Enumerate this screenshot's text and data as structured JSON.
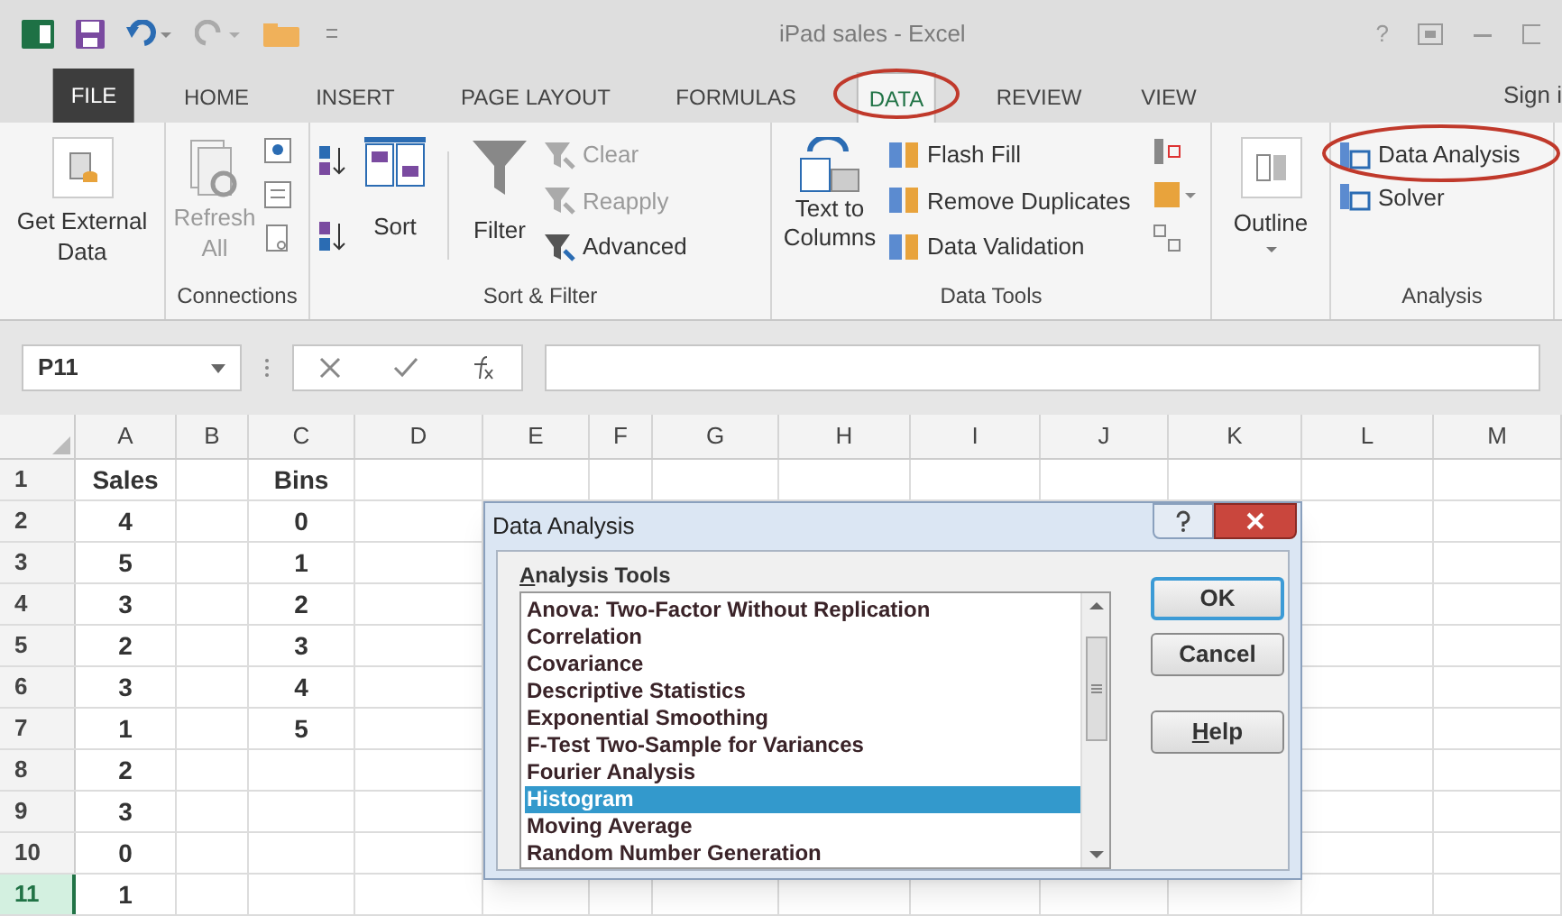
{
  "window": {
    "title": "iPad sales - Excel",
    "help": "?"
  },
  "tabs": [
    {
      "label": "FILE",
      "kind": "file",
      "selected": false,
      "highlighted": false
    },
    {
      "label": "HOME",
      "kind": "tab",
      "selected": false,
      "highlighted": false
    },
    {
      "label": "INSERT",
      "kind": "tab",
      "selected": false,
      "highlighted": false
    },
    {
      "label": "PAGE LAYOUT",
      "kind": "tab",
      "selected": false,
      "highlighted": false
    },
    {
      "label": "FORMULAS",
      "kind": "tab",
      "selected": false,
      "highlighted": false
    },
    {
      "label": "DATA",
      "kind": "tab",
      "selected": true,
      "highlighted": true
    },
    {
      "label": "REVIEW",
      "kind": "tab",
      "selected": false,
      "highlighted": false
    },
    {
      "label": "VIEW",
      "kind": "tab",
      "selected": false,
      "highlighted": false
    }
  ],
  "account": "Sign i",
  "ribbon": {
    "get_external_data": {
      "label": "Get External Data"
    },
    "connections": {
      "title": "Connections",
      "refresh": {
        "label": "Refresh All",
        "disabled": true
      }
    },
    "sort_filter": {
      "title": "Sort & Filter",
      "sort": "Sort",
      "filter": "Filter",
      "commands": [
        {
          "label": "Clear",
          "disabled": true
        },
        {
          "label": "Reapply",
          "disabled": true
        },
        {
          "label": "Advanced",
          "disabled": false
        }
      ]
    },
    "data_tools": {
      "title": "Data Tools",
      "text_to_columns": "Text to Columns",
      "commands": [
        {
          "label": "Flash Fill"
        },
        {
          "label": "Remove Duplicates"
        },
        {
          "label": "Data Validation"
        }
      ]
    },
    "outline": {
      "label": "Outline"
    },
    "analysis": {
      "title": "Analysis",
      "commands": [
        {
          "label": "Data Analysis",
          "highlighted": true
        },
        {
          "label": "Solver",
          "highlighted": false
        }
      ]
    }
  },
  "formula_bar": {
    "name_box": "P11"
  },
  "sheet": {
    "columns": [
      "A",
      "B",
      "C",
      "D",
      "E",
      "F",
      "G",
      "H",
      "I",
      "J",
      "K",
      "L",
      "M"
    ],
    "rows": [
      {
        "number": "1",
        "selected": false,
        "a": "Sales",
        "c": "Bins"
      },
      {
        "number": "2",
        "selected": false,
        "a": "4",
        "c": "0"
      },
      {
        "number": "3",
        "selected": false,
        "a": "5",
        "c": "1"
      },
      {
        "number": "4",
        "selected": false,
        "a": "3",
        "c": "2"
      },
      {
        "number": "5",
        "selected": false,
        "a": "2",
        "c": "3"
      },
      {
        "number": "6",
        "selected": false,
        "a": "3",
        "c": "4"
      },
      {
        "number": "7",
        "selected": false,
        "a": "1",
        "c": "5"
      },
      {
        "number": "8",
        "selected": false,
        "a": "2"
      },
      {
        "number": "9",
        "selected": false,
        "a": "3"
      },
      {
        "number": "10",
        "selected": false,
        "a": "0"
      },
      {
        "number": "11",
        "selected": true,
        "a": "1"
      }
    ]
  },
  "dialog": {
    "title": "Data Analysis",
    "list_label": "Analysis Tools",
    "list_label_underline_first": true,
    "items": [
      {
        "label": "Anova: Two-Factor Without Replication",
        "selected": false
      },
      {
        "label": "Correlation",
        "selected": false
      },
      {
        "label": "Covariance",
        "selected": false
      },
      {
        "label": "Descriptive Statistics",
        "selected": false
      },
      {
        "label": "Exponential Smoothing",
        "selected": false
      },
      {
        "label": "F-Test Two-Sample for Variances",
        "selected": false
      },
      {
        "label": "Fourier Analysis",
        "selected": false
      },
      {
        "label": "Histogram",
        "selected": true
      },
      {
        "label": "Moving Average",
        "selected": false
      },
      {
        "label": "Random Number Generation",
        "selected": false
      }
    ],
    "buttons": [
      {
        "label": "OK",
        "default": true,
        "underline_first": false
      },
      {
        "label": "Cancel",
        "default": false,
        "underline_first": false
      },
      {
        "label": "Help",
        "default": false,
        "underline_first": true
      }
    ]
  }
}
